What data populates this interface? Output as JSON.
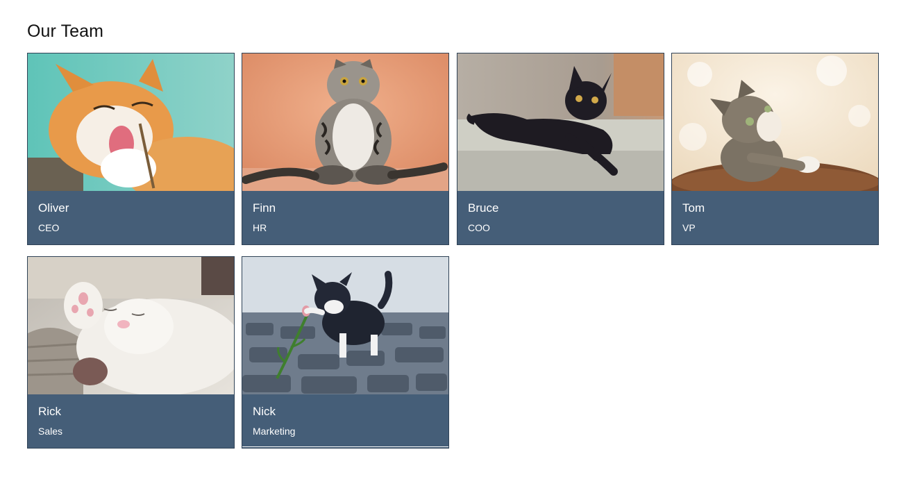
{
  "page": {
    "title": "Our Team"
  },
  "team": [
    {
      "name": "Oliver",
      "role": "CEO",
      "photo_icon": "orange-tabby-cat-photo"
    },
    {
      "name": "Finn",
      "role": "HR",
      "photo_icon": "silver-tabby-cat-sitting-photo"
    },
    {
      "name": "Bruce",
      "role": "COO",
      "photo_icon": "black-cat-on-bed-photo"
    },
    {
      "name": "Tom",
      "role": "VP",
      "photo_icon": "tabby-kitten-looking-up-photo"
    },
    {
      "name": "Rick",
      "role": "Sales",
      "photo_icon": "white-cat-sleeping-photo"
    },
    {
      "name": "Nick",
      "role": "Marketing",
      "photo_icon": "black-white-kitten-playing-photo"
    }
  ],
  "colors": {
    "caption_bg": "#455e78",
    "card_border": "#2f4256",
    "text_on_caption": "#ffffff"
  }
}
